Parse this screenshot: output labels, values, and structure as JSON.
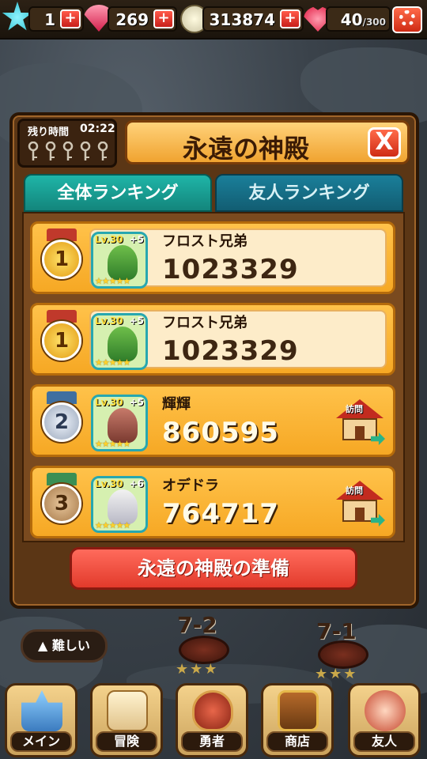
{
  "topbar": {
    "stars": "1",
    "gems": "269",
    "coins": "313874",
    "stamina": "40",
    "stamina_max": "300"
  },
  "panel": {
    "timer_label": "残り時間",
    "timer_value": "02:22",
    "title": "永遠の神殿",
    "close_label": "X"
  },
  "tabs": [
    {
      "label": "全体ランキング",
      "active": true
    },
    {
      "label": "友人ランキング",
      "active": false
    }
  ],
  "ranking": [
    {
      "rank": "1",
      "medal": "gold",
      "level": "Lv.30",
      "plus": "+5",
      "name": "フロスト兄弟",
      "score": "1023329",
      "stars": "★★★★★",
      "mine": true
    },
    {
      "rank": "1",
      "medal": "gold",
      "level": "Lv.30",
      "plus": "+5",
      "name": "フロスト兄弟",
      "score": "1023329",
      "stars": "★★★★★",
      "mine": true
    },
    {
      "rank": "2",
      "medal": "silver",
      "level": "Lv.30",
      "plus": "+5",
      "name": "輝輝",
      "score": "860595",
      "stars": "★★★★★",
      "mine": false,
      "visit_label": "訪問"
    },
    {
      "rank": "3",
      "medal": "bronze",
      "level": "Lv.30",
      "plus": "+6",
      "name": "オデドラ",
      "score": "764717",
      "stars": "★★★★★",
      "mine": false,
      "visit_label": "訪問"
    }
  ],
  "prepare_button": "永遠の神殿の準備",
  "map": {
    "difficulty": "▲ 難しい",
    "stage_a": "7-2",
    "stage_b": "7-1",
    "stage_stars": "★★★"
  },
  "nav": [
    {
      "label": "メイン",
      "icon": "castle-icon"
    },
    {
      "label": "冒険",
      "icon": "map-icon"
    },
    {
      "label": "勇者",
      "icon": "sword-icon"
    },
    {
      "label": "商店",
      "icon": "chest-icon"
    },
    {
      "label": "友人",
      "icon": "friends-icon"
    }
  ],
  "colors": {
    "panel": "#5b3615",
    "row": "#f6a824",
    "tab_active": "#1fb5a8",
    "tab_inactive": "#1a7f9a",
    "button_red": "#e23a2b"
  }
}
